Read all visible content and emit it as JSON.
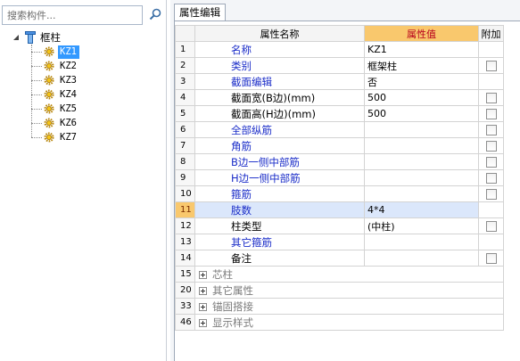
{
  "search": {
    "placeholder": "搜索构件..."
  },
  "tree": {
    "root_label": "框柱",
    "items": [
      {
        "label": "KZ1",
        "selected": true
      },
      {
        "label": "KZ2"
      },
      {
        "label": "KZ3"
      },
      {
        "label": "KZ4"
      },
      {
        "label": "KZ5"
      },
      {
        "label": "KZ6"
      },
      {
        "label": "KZ7"
      }
    ]
  },
  "tab": {
    "label": "属性编辑"
  },
  "grid": {
    "headers": {
      "name": "属性名称",
      "value": "属性值",
      "extra": "附加"
    },
    "rows": [
      {
        "num": "1",
        "name": "名称",
        "value": "KZ1",
        "style": "link",
        "checkbox": false
      },
      {
        "num": "2",
        "name": "类别",
        "value": "框架柱",
        "style": "link",
        "checkbox": true
      },
      {
        "num": "3",
        "name": "截面编辑",
        "value": "否",
        "style": "link",
        "checkbox": false
      },
      {
        "num": "4",
        "name": "截面宽(B边)(mm)",
        "value": "500",
        "style": "plain",
        "checkbox": true
      },
      {
        "num": "5",
        "name": "截面高(H边)(mm)",
        "value": "500",
        "style": "plain",
        "checkbox": true
      },
      {
        "num": "6",
        "name": "全部纵筋",
        "value": "",
        "style": "link",
        "checkbox": true
      },
      {
        "num": "7",
        "name": "角筋",
        "value": "",
        "style": "link",
        "checkbox": true
      },
      {
        "num": "8",
        "name": "B边一侧中部筋",
        "value": "",
        "style": "link",
        "checkbox": true
      },
      {
        "num": "9",
        "name": "H边一侧中部筋",
        "value": "",
        "style": "link",
        "checkbox": true
      },
      {
        "num": "10",
        "name": "箍筋",
        "value": "",
        "style": "link",
        "checkbox": true
      },
      {
        "num": "11",
        "name": "肢数",
        "value": "4*4",
        "style": "link",
        "checkbox": false,
        "selected": true
      },
      {
        "num": "12",
        "name": "柱类型",
        "value": "(中柱)",
        "style": "plain",
        "checkbox": true
      },
      {
        "num": "13",
        "name": "其它箍筋",
        "value": "",
        "style": "link",
        "checkbox": false
      },
      {
        "num": "14",
        "name": "备注",
        "value": "",
        "style": "plain",
        "checkbox": true
      },
      {
        "num": "15",
        "name": "芯柱",
        "value": "",
        "style": "group",
        "checkbox": false
      },
      {
        "num": "20",
        "name": "其它属性",
        "value": "",
        "style": "group",
        "checkbox": false
      },
      {
        "num": "33",
        "name": "锚固搭接",
        "value": "",
        "style": "group",
        "checkbox": false
      },
      {
        "num": "46",
        "name": "显示样式",
        "value": "",
        "style": "group",
        "checkbox": false
      }
    ]
  },
  "colors": {
    "selection_blue": "#3399ff",
    "value_header": "#f9c86d",
    "link_text": "#1a2cc8",
    "selected_row": "#dbe7fb"
  },
  "icons": {
    "search": "search-icon",
    "root": "column-category-icon",
    "item": "gear-icon",
    "expander": "collapse-triangle-icon",
    "group": "plus-expand-icon"
  }
}
